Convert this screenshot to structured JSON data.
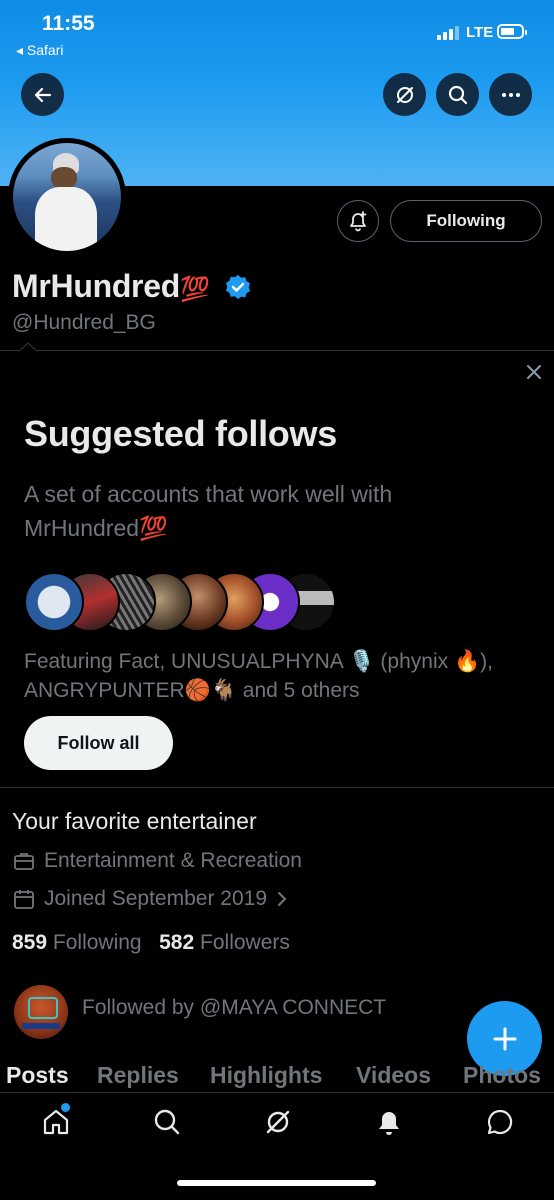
{
  "status_bar": {
    "time": "11:55",
    "back_app": "◂ Safari",
    "network": "LTE"
  },
  "profile": {
    "name": "MrHundred",
    "name_emoji": "💯",
    "handle": "@Hundred_BG",
    "following_button": "Following",
    "bio": "Your favorite entertainer",
    "category": "Entertainment & Recreation",
    "joined": "Joined September 2019",
    "following_count": "859",
    "following_label": "Following",
    "followers_count": "582",
    "followers_label": "Followers",
    "followed_by": "Followed by @MAYA CONNECT"
  },
  "suggested": {
    "title": "Suggested follows",
    "description_line1": "A set of accounts that work well with",
    "description_line2": "MrHundred💯",
    "featuring_line1": "Featuring Fact, UNUSUALPHYNA 🎙️ (phynix 🔥),",
    "featuring_line2": "ANGRYPUNTER🏀🐐  and 5 others",
    "follow_all": "Follow all"
  },
  "tabs": [
    {
      "label": "Posts",
      "active": true
    },
    {
      "label": "Replies"
    },
    {
      "label": "Highlights"
    },
    {
      "label": "Videos"
    },
    {
      "label": "Photos"
    }
  ],
  "icons": [
    "back-arrow-icon",
    "grok-icon",
    "search-icon",
    "more-icon",
    "bell-plus-icon",
    "close-icon",
    "briefcase-icon",
    "calendar-icon",
    "chevron-right-icon",
    "plus-icon",
    "home-icon",
    "search-icon",
    "grok-icon",
    "bell-icon",
    "message-icon"
  ],
  "colors": {
    "accent": "#1d9bf0",
    "verified": "#1d9bf0"
  }
}
